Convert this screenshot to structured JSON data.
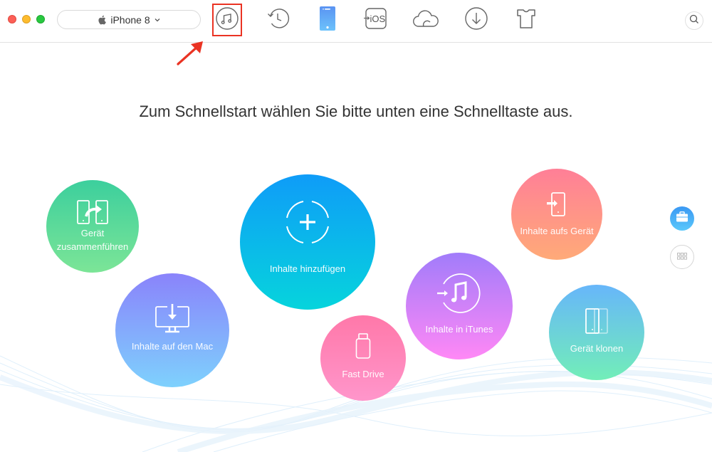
{
  "window": {
    "controls": [
      "close",
      "minimize",
      "maximize"
    ]
  },
  "toolbar": {
    "device_selector": {
      "icon": "apple-icon",
      "label": "iPhone 8",
      "chevron": "chevron-down-icon"
    },
    "tools": [
      {
        "id": "itunes-library",
        "icon": "music-note-icon",
        "highlighted": true
      },
      {
        "id": "backup-history",
        "icon": "history-clock-icon"
      },
      {
        "id": "device-manager",
        "icon": "iphone-icon",
        "active": true
      },
      {
        "id": "ios-mover",
        "icon": "to-ios-icon",
        "text": "→iOS"
      },
      {
        "id": "icloud",
        "icon": "cloud-icon"
      },
      {
        "id": "downloader",
        "icon": "download-icon"
      },
      {
        "id": "toolkit",
        "icon": "shirt-icon"
      }
    ],
    "search_icon": "search-icon"
  },
  "annotation": {
    "arrow_color": "#ea3323",
    "highlight_color": "#ea3323"
  },
  "main": {
    "headline": "Zum Schnellstart wählen Sie bitte unten eine Schnelltaste aus.",
    "quick_buttons": [
      {
        "id": "merge",
        "label_line1": "Gerät",
        "label_line2": "zusammenführen",
        "icon": "merge-devices-icon",
        "colors": [
          "#3ccf9d",
          "#7ce597"
        ]
      },
      {
        "id": "add",
        "label": "Inhalte hinzufügen",
        "icon": "add-content-icon",
        "colors": [
          "#0f9cf8",
          "#06d4dc"
        ]
      },
      {
        "id": "to-device",
        "label": "Inhalte aufs Gerät",
        "icon": "to-device-icon",
        "colors": [
          "#ff7f97",
          "#ffaa78"
        ]
      },
      {
        "id": "to-mac",
        "label": "Inhalte auf den Mac",
        "icon": "to-mac-icon",
        "colors": [
          "#8a83fb",
          "#7ed1fd"
        ]
      },
      {
        "id": "to-itunes",
        "label": "Inhalte in iTunes",
        "icon": "to-itunes-icon",
        "colors": [
          "#a17cfa",
          "#ff88f6"
        ]
      },
      {
        "id": "fast-drive",
        "label": "Fast Drive",
        "icon": "usb-drive-icon",
        "colors": [
          "#ff78a9",
          "#ff96cb"
        ]
      },
      {
        "id": "clone",
        "label": "Gerät klonen",
        "icon": "clone-device-icon",
        "colors": [
          "#67b6fa",
          "#72eeb8"
        ]
      }
    ]
  },
  "sidebar": {
    "buttons": [
      {
        "id": "toolbox",
        "icon": "briefcase-icon",
        "active": true
      },
      {
        "id": "apps",
        "icon": "grid-icon",
        "active": false
      }
    ]
  }
}
